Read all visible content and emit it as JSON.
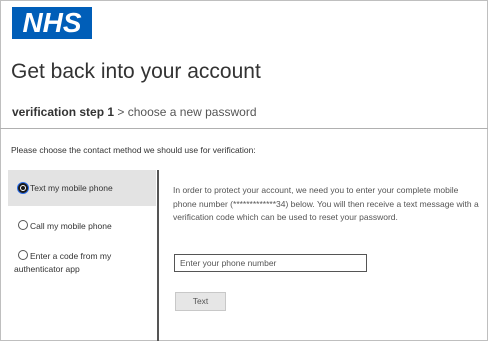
{
  "brand": {
    "logo_text": "NHS",
    "color": "#005eb8"
  },
  "page": {
    "title": "Get back into your account"
  },
  "steps": {
    "active": "verification step 1",
    "separator": ">",
    "next": "choose a new password"
  },
  "prompt": "Please choose the contact method we should use for verification:",
  "options": [
    {
      "label": "Text my mobile phone",
      "selected": true
    },
    {
      "label": "Call my mobile phone",
      "selected": false
    },
    {
      "label_line1": "Enter a code from my",
      "label_line2": "authenticator app",
      "selected": false
    }
  ],
  "info": {
    "text": "In order to protect your account, we need you to enter your complete mobile phone number (*************34) below. You will then receive a text message with a verification code which can be used to reset your password."
  },
  "phone_input": {
    "placeholder": "Enter your phone number",
    "value": ""
  },
  "submit": {
    "label": "Text"
  },
  "icons": {
    "radio_checked": "radio-selected-icon",
    "radio_unchecked": "radio-unselected-icon"
  }
}
